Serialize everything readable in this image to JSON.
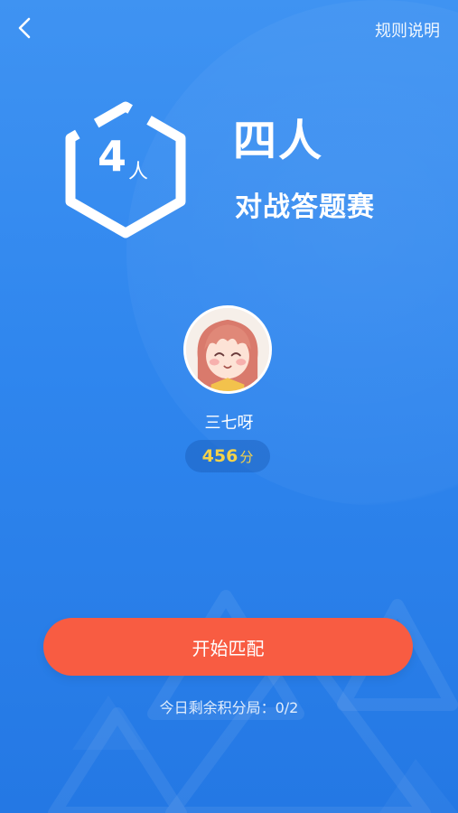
{
  "header": {
    "back_icon": "chevron-left-icon",
    "rules_label": "规则说明"
  },
  "badge": {
    "number": "4",
    "unit": "人"
  },
  "title": {
    "main": "四人",
    "sub": "对战答题赛"
  },
  "player": {
    "name": "三七呀",
    "score": "456",
    "score_unit": "分"
  },
  "actions": {
    "start_label": "开始匹配"
  },
  "footer": {
    "remaining_text": "今日剩余积分局：0/2"
  },
  "colors": {
    "background": "#3f93f2",
    "start_button": "#f85c42",
    "score": "#f4d24a"
  }
}
